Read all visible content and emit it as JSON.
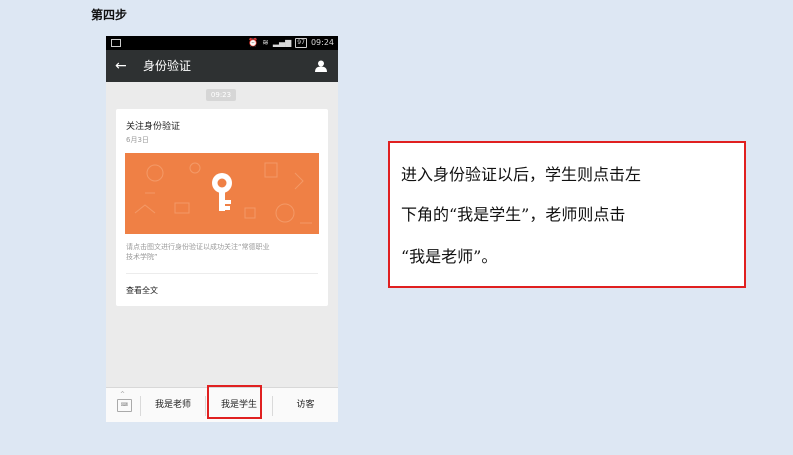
{
  "step_label": "第四步",
  "phone": {
    "status": {
      "time": "09:24",
      "battery": "97"
    },
    "title": "身份验证",
    "chat_time": "09:23",
    "card": {
      "title": "关注身份验证",
      "date": "6月3日",
      "desc_line1": "请点击图文进行身份验证以成功关注“常德职业",
      "desc_line2": "技术学院”",
      "read_all": "查看全文"
    },
    "bottom": {
      "items": [
        "我是老师",
        "我是学生",
        "访客"
      ]
    }
  },
  "callout": {
    "line1": "进入身份验证以后，学生则点击左",
    "line2": "下角的“我是学生”，老师则点击",
    "line3": "“我是老师”。"
  },
  "colors": {
    "accent_red": "#e02020",
    "banner_orange": "#ef8045",
    "titlebar": "#2e3132"
  }
}
